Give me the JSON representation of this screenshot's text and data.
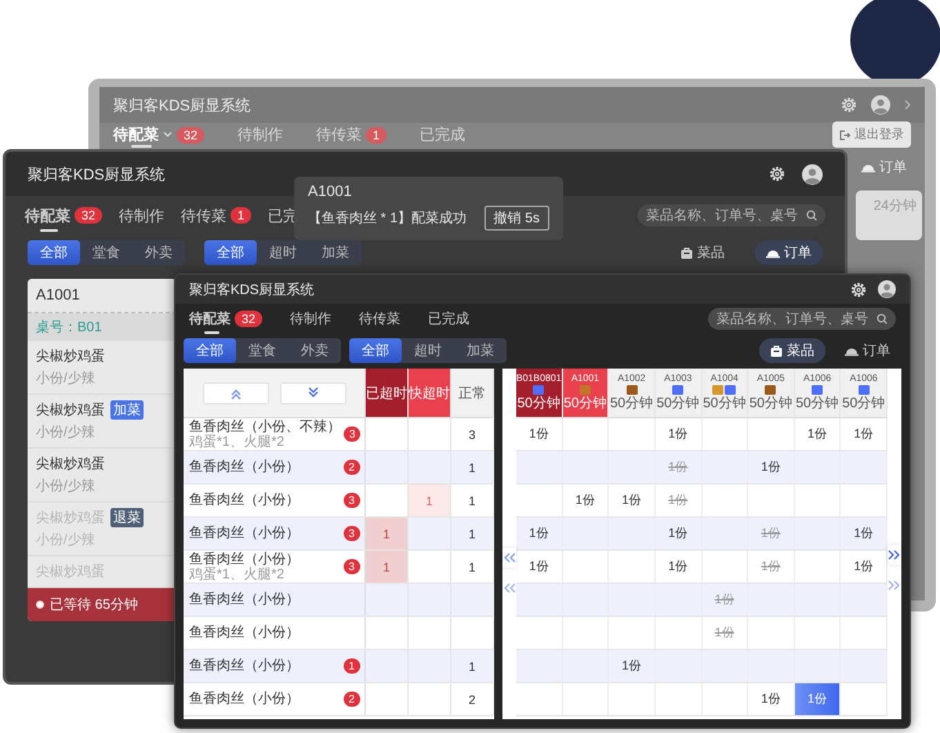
{
  "back_window": {
    "title": "聚归客KDS厨显系统",
    "tabs": [
      {
        "label": "待配菜",
        "badge": "32",
        "dropdown": true,
        "selected": true
      },
      {
        "label": "待制作",
        "dropdown": false,
        "selected": false
      },
      {
        "label": "待传菜",
        "badge": "1",
        "dropdown": false,
        "selected": false
      },
      {
        "label": "已完成",
        "dropdown": false,
        "selected": false
      }
    ],
    "logout": "退出登录",
    "view_toggle": "订单",
    "card_time": "24分钟"
  },
  "middle_window": {
    "title": "聚归客KDS厨显系统",
    "tabs": [
      {
        "label": "待配菜",
        "badge": "32",
        "selected": true
      },
      {
        "label": "待制作",
        "selected": false
      },
      {
        "label": "待传菜",
        "badge": "1",
        "selected": false
      },
      {
        "label": "已完",
        "selected": false
      }
    ],
    "search": {
      "placeholder": "菜品名称、订单号、桌号"
    },
    "filter_groups": [
      {
        "options": [
          {
            "label": "全部",
            "selected": true
          },
          {
            "label": "堂食",
            "selected": false
          },
          {
            "label": "外卖",
            "selected": false
          }
        ]
      },
      {
        "options": [
          {
            "label": "全部",
            "selected": true
          },
          {
            "label": "超时",
            "selected": false
          },
          {
            "label": "加菜",
            "selected": false
          }
        ]
      }
    ],
    "views": [
      {
        "label": "菜品",
        "kind": "dish",
        "selected": false
      },
      {
        "label": "订单",
        "kind": "order",
        "selected": true
      }
    ],
    "order_card": {
      "order_no": "A1001",
      "table": "桌号：B01",
      "items": [
        {
          "name": "尖椒炒鸡蛋",
          "spec": "小份/少辣",
          "disabled": false
        },
        {
          "name": "尖椒炒鸡蛋",
          "spec": "小份/少辣",
          "tag": {
            "label": "加菜",
            "kind": "add"
          },
          "disabled": false
        },
        {
          "name": "尖椒炒鸡蛋",
          "spec": "小份/少辣",
          "disabled": false
        },
        {
          "name": "尖椒炒鸡蛋",
          "spec": "小份/少辣",
          "tag": {
            "label": "退菜",
            "kind": "return"
          },
          "disabled": true
        },
        {
          "name": "尖椒炒鸡蛋",
          "disabled": true
        }
      ],
      "wait": "已等待 65分钟"
    }
  },
  "toast": {
    "title": "A1001",
    "message": "【鱼香肉丝 * 1】配菜成功",
    "action": "撤销 5s"
  },
  "front_window": {
    "title": "聚归客KDS厨显系统",
    "tabs": [
      {
        "label": "待配菜",
        "badge": "32",
        "selected": true
      },
      {
        "label": "待制作",
        "selected": false
      },
      {
        "label": "待传菜",
        "selected": false
      },
      {
        "label": "已完成",
        "selected": false
      }
    ],
    "search": {
      "placeholder": "菜品名称、订单号、桌号"
    },
    "filter_groups": [
      {
        "options": [
          {
            "label": "全部",
            "selected": true
          },
          {
            "label": "堂食",
            "selected": false
          },
          {
            "label": "外卖",
            "selected": false
          }
        ]
      },
      {
        "options": [
          {
            "label": "全部",
            "selected": true
          },
          {
            "label": "超时",
            "selected": false
          },
          {
            "label": "加菜",
            "selected": false
          }
        ]
      }
    ],
    "views": [
      {
        "label": "菜品",
        "kind": "dish",
        "selected": true
      },
      {
        "label": "订单",
        "kind": "order",
        "selected": false
      }
    ],
    "status_columns": [
      {
        "label": "已超时",
        "kind": "overdue"
      },
      {
        "label": "快超时",
        "kind": "nearing"
      },
      {
        "label": "正常",
        "kind": "normal"
      }
    ],
    "orders": [
      {
        "code": "B01B0801",
        "kind": "overdue",
        "tags": [
          {
            "color": "#4f6ef7"
          }
        ],
        "time": "50分钟"
      },
      {
        "code": "A1001",
        "kind": "nearing",
        "tags": [
          {
            "color": "#c0752a"
          }
        ],
        "time": "50分钟"
      },
      {
        "code": "A1002",
        "kind": "normal",
        "tags": [
          {
            "color": "#9a5a1c"
          }
        ],
        "time": "50分钟"
      },
      {
        "code": "A1003",
        "kind": "normal",
        "tags": [
          {
            "color": "#4f6ef7"
          }
        ],
        "time": "50分钟"
      },
      {
        "code": "A1004",
        "kind": "normal",
        "tags": [
          {
            "color": "#d9962b"
          },
          {
            "color": "#4f6ef7"
          }
        ],
        "time": "50分钟"
      },
      {
        "code": "A1005",
        "kind": "normal",
        "tags": [
          {
            "color": "#9a5a1c"
          }
        ],
        "time": "50分钟"
      },
      {
        "code": "A1006",
        "kind": "normal",
        "tags": [
          {
            "color": "#4f6ef7"
          }
        ],
        "time": "50分钟"
      },
      {
        "code": "A1006",
        "kind": "normal",
        "tags": [
          {
            "color": "#4f6ef7"
          }
        ],
        "time": "50分钟"
      }
    ],
    "dishes": [
      {
        "name": "鱼香肉丝（小份、不辣）",
        "note": "鸡蛋*1、火腿*2",
        "badge": "3",
        "normal": "3",
        "cells": [
          {
            "text": "1份",
            "kind": "normal"
          },
          {
            "kind": "empty"
          },
          {
            "kind": "empty"
          },
          {
            "text": "1份",
            "kind": "normal"
          },
          {
            "kind": "empty"
          },
          {
            "kind": "empty"
          },
          {
            "text": "1份",
            "kind": "normal"
          },
          {
            "text": "1份",
            "kind": "normal"
          }
        ]
      },
      {
        "name": "鱼香肉丝（小份）",
        "badge": "2",
        "normal": "1",
        "cells": [
          {
            "kind": "empty"
          },
          {
            "kind": "empty"
          },
          {
            "kind": "empty"
          },
          {
            "text": "1份",
            "kind": "done"
          },
          {
            "kind": "empty"
          },
          {
            "text": "1份",
            "kind": "normal"
          },
          {
            "kind": "empty"
          },
          {
            "kind": "empty"
          }
        ]
      },
      {
        "name": "鱼香肉丝（小份）",
        "badge": "3",
        "nearing": "1",
        "normal": "1",
        "cells": [
          {
            "kind": "empty"
          },
          {
            "text": "1份",
            "kind": "normal"
          },
          {
            "text": "1份",
            "kind": "normal"
          },
          {
            "text": "1份",
            "kind": "done"
          },
          {
            "kind": "empty"
          },
          {
            "kind": "empty"
          },
          {
            "kind": "empty"
          },
          {
            "kind": "empty"
          }
        ]
      },
      {
        "name": "鱼香肉丝（小份）",
        "badge": "3",
        "overdue": "1",
        "normal": "1",
        "cells": [
          {
            "text": "1份",
            "kind": "normal"
          },
          {
            "kind": "empty"
          },
          {
            "kind": "empty"
          },
          {
            "text": "1份",
            "kind": "normal"
          },
          {
            "kind": "empty"
          },
          {
            "text": "1份",
            "kind": "done"
          },
          {
            "kind": "empty"
          },
          {
            "text": "1份",
            "kind": "normal"
          }
        ]
      },
      {
        "name": "鱼香肉丝（小份）",
        "note": "鸡蛋*1、火腿*2",
        "badge": "3",
        "overdue": "1",
        "normal": "1",
        "cells": [
          {
            "text": "1份",
            "kind": "normal"
          },
          {
            "kind": "empty"
          },
          {
            "kind": "empty"
          },
          {
            "text": "1份",
            "kind": "normal"
          },
          {
            "kind": "empty"
          },
          {
            "text": "1份",
            "kind": "done"
          },
          {
            "kind": "empty"
          },
          {
            "text": "1份",
            "kind": "normal"
          }
        ]
      },
      {
        "name": "鱼香肉丝（小份）",
        "cells": [
          {
            "kind": "empty"
          },
          {
            "kind": "empty"
          },
          {
            "kind": "empty"
          },
          {
            "kind": "empty"
          },
          {
            "text": "1份",
            "kind": "done"
          },
          {
            "kind": "empty"
          },
          {
            "kind": "empty"
          },
          {
            "kind": "empty"
          }
        ]
      },
      {
        "name": "鱼香肉丝（小份）",
        "cells": [
          {
            "kind": "empty"
          },
          {
            "kind": "empty"
          },
          {
            "kind": "empty"
          },
          {
            "kind": "empty"
          },
          {
            "text": "1份",
            "kind": "done"
          },
          {
            "kind": "empty"
          },
          {
            "kind": "empty"
          },
          {
            "kind": "empty"
          }
        ]
      },
      {
        "name": "鱼香肉丝（小份）",
        "badge": "1",
        "normal": "1",
        "cells": [
          {
            "kind": "empty"
          },
          {
            "kind": "empty"
          },
          {
            "text": "1份",
            "kind": "normal"
          },
          {
            "kind": "empty"
          },
          {
            "kind": "empty"
          },
          {
            "kind": "empty"
          },
          {
            "kind": "empty"
          },
          {
            "kind": "empty"
          }
        ]
      },
      {
        "name": "鱼香肉丝（小份）",
        "badge": "2",
        "normal": "2",
        "cells": [
          {
            "kind": "empty"
          },
          {
            "kind": "empty"
          },
          {
            "kind": "empty"
          },
          {
            "kind": "empty"
          },
          {
            "kind": "empty"
          },
          {
            "text": "1份",
            "kind": "normal"
          },
          {
            "text": "1份",
            "kind": "selected"
          },
          {
            "kind": "empty"
          }
        ]
      }
    ]
  }
}
